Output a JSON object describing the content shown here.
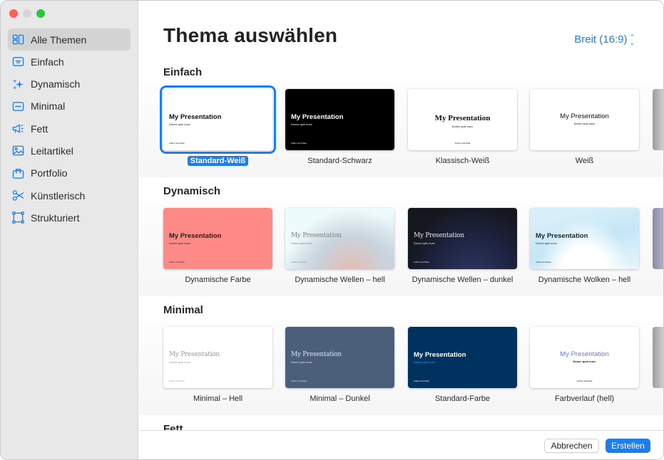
{
  "window": {
    "traffic_lights": [
      "close",
      "minimize",
      "maximize"
    ]
  },
  "sidebar": {
    "items": [
      {
        "label": "Alle Themen",
        "icon": "all-themes-icon",
        "active": true
      },
      {
        "label": "Einfach",
        "icon": "simple-icon",
        "active": false
      },
      {
        "label": "Dynamisch",
        "icon": "sparkles-icon",
        "active": false
      },
      {
        "label": "Minimal",
        "icon": "minimal-icon",
        "active": false
      },
      {
        "label": "Fett",
        "icon": "megaphone-icon",
        "active": false
      },
      {
        "label": "Leitartikel",
        "icon": "photo-icon",
        "active": false
      },
      {
        "label": "Portfolio",
        "icon": "briefcase-icon",
        "active": false
      },
      {
        "label": "Künstlerisch",
        "icon": "scissors-icon",
        "active": false
      },
      {
        "label": "Strukturiert",
        "icon": "frame-icon",
        "active": false
      }
    ]
  },
  "header": {
    "title": "Thema auswählen",
    "size_select": "Breit (16:9)"
  },
  "thumb_text": {
    "title": "My Presentation",
    "subtitle": "Donec quis nunc",
    "author": "Author and Date"
  },
  "sections": [
    {
      "title": "Einfach",
      "themes": [
        {
          "label": "Standard-Weiß",
          "selected": true
        },
        {
          "label": "Standard-Schwarz",
          "selected": false
        },
        {
          "label": "Klassisch-Weiß",
          "selected": false
        },
        {
          "label": "Weiß",
          "selected": false
        }
      ]
    },
    {
      "title": "Dynamisch",
      "themes": [
        {
          "label": "Dynamische Farbe",
          "selected": false
        },
        {
          "label": "Dynamische Wellen – hell",
          "selected": false
        },
        {
          "label": "Dynamische Wellen – dunkel",
          "selected": false
        },
        {
          "label": "Dynamische Wolken – hell",
          "selected": false
        }
      ]
    },
    {
      "title": "Minimal",
      "themes": [
        {
          "label": "Minimal – Hell",
          "selected": false
        },
        {
          "label": "Minimal – Dunkel",
          "selected": false
        },
        {
          "label": "Standard-Farbe",
          "selected": false
        },
        {
          "label": "Farbverlauf (hell)",
          "selected": false
        }
      ]
    },
    {
      "title": "Fett",
      "themes": []
    }
  ],
  "footer": {
    "cancel_label": "Abbrechen",
    "create_label": "Erstellen"
  },
  "colors": {
    "accent": "#1b7df0",
    "sidebar_bg": "#e8e8e8",
    "dynamic_color": "#fe8a87",
    "standard_color": "#00325f",
    "minimal_dark": "#4b5e7a"
  }
}
